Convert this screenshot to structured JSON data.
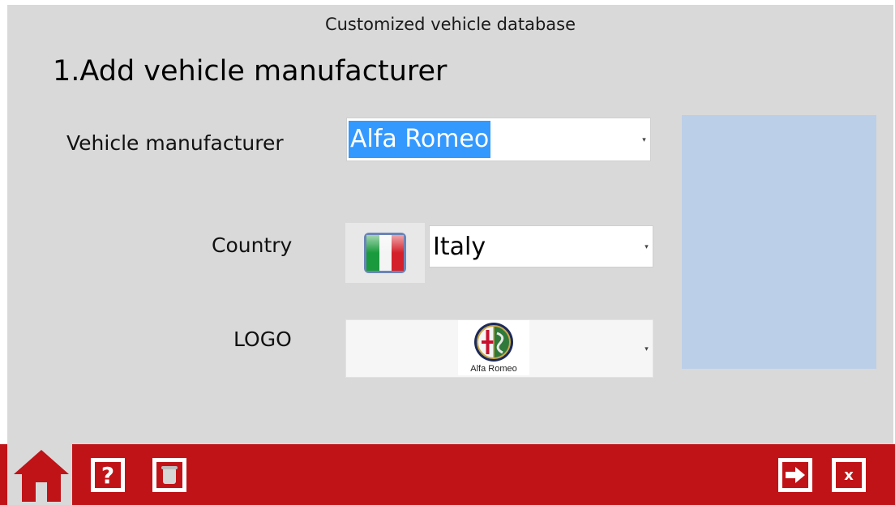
{
  "window": {
    "title": "Customized vehicle database"
  },
  "form": {
    "heading": "1.Add vehicle manufacturer",
    "manufacturer": {
      "label": "Vehicle manufacturer",
      "value": "Alfa Romeo"
    },
    "country": {
      "label": "Country",
      "value": "Italy",
      "flag_icon": "italy-flag-icon"
    },
    "logo": {
      "label": "LOGO",
      "caption": "Alfa Romeo",
      "icon": "alfa-romeo-logo-icon"
    }
  },
  "toolbar": {
    "home_icon": "home-icon",
    "help_icon": "help-icon",
    "delete_icon": "trash-icon",
    "next_icon": "arrow-right-icon",
    "close_label": "x",
    "close_icon": "close-icon"
  },
  "colors": {
    "toolbar_bg": "#c01318",
    "panel_bg": "#d9d9d9",
    "selection": "#3399ff",
    "preview_bg": "#bccfe8"
  }
}
